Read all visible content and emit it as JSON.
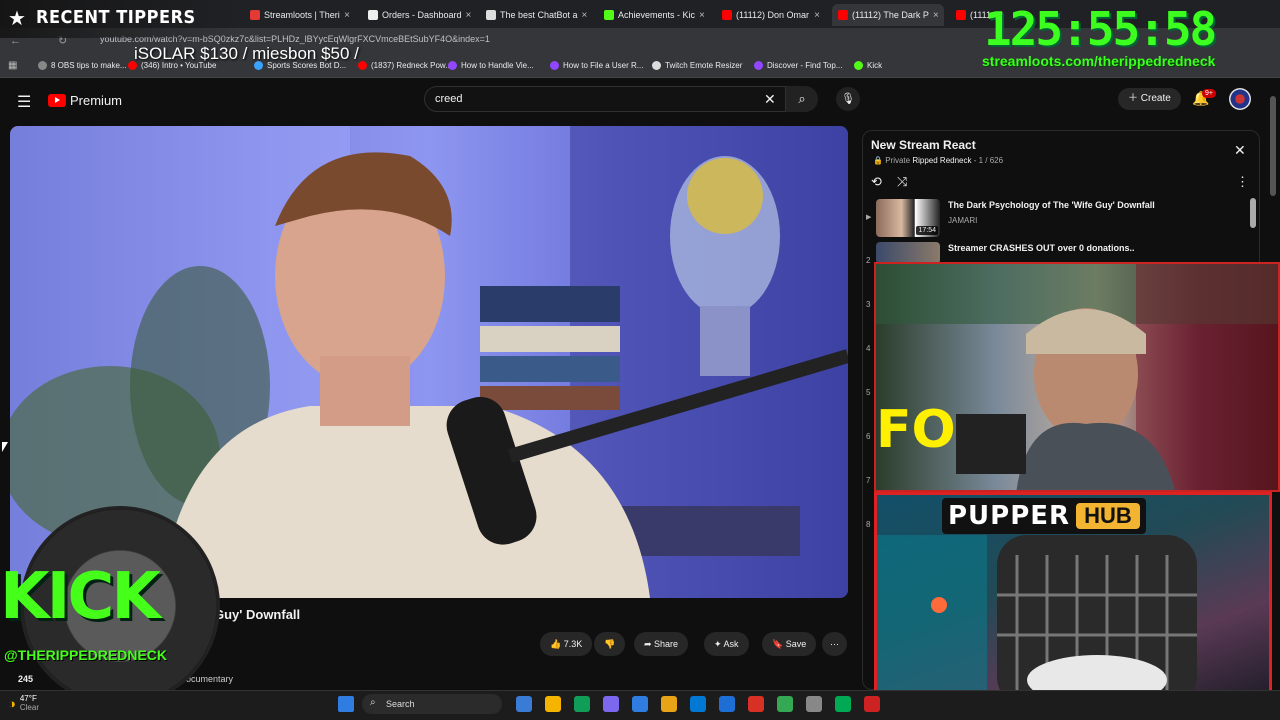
{
  "browser": {
    "tabs": [
      {
        "title": "Streamloots | Theri",
        "color": "#e53935"
      },
      {
        "title": "Orders - Dashboard",
        "color": "#eeeeee"
      },
      {
        "title": "The best ChatBot a",
        "color": "#dddddd"
      },
      {
        "title": "Achievements - Kic",
        "color": "#53fc18"
      },
      {
        "title": "(11112) Don Omar",
        "color": "#ff0000"
      },
      {
        "title": "(11112) The Dark P",
        "color": "#ff0000"
      },
      {
        "title": "(1111",
        "color": "#ff0000"
      }
    ],
    "url": "youtube.com/watch?v=m-bSQ0zkz7c&list=PLHDz_lBYycEqWlgrFXCVmceBEtSubYF4O&index=1",
    "bookmarks": [
      {
        "label": "8 OBS tips to make...",
        "color": "#888888"
      },
      {
        "label": "(346) Intro • YouTube",
        "color": "#ff0000"
      },
      {
        "label": "Sports Scores Bot D...",
        "color": "#3aa3ff"
      },
      {
        "label": "(1837) Redneck Pow...",
        "color": "#ff0000"
      },
      {
        "label": "How to Handle Vie...",
        "color": "#9146ff"
      },
      {
        "label": "How to File a User R...",
        "color": "#9146ff"
      },
      {
        "label": "Twitch Emote Resizer",
        "color": "#dddddd"
      },
      {
        "label": "Discover - Find Top...",
        "color": "#9146ff"
      },
      {
        "label": "Kick",
        "color": "#53fc18"
      }
    ]
  },
  "youtube": {
    "logo_text": "Premium",
    "search_value": "creed",
    "create_label": "Create",
    "notif_badge": "9+",
    "video_title_visible": "Guy' Downfall",
    "actions": {
      "likes": "7.3K",
      "share": "Share",
      "ask": "Ask",
      "save": "Save"
    },
    "views_partial": "245",
    "desc_partial": "ocumentary"
  },
  "playlist": {
    "title": "New Stream React",
    "privacy": "Private",
    "owner": "Ripped Redneck",
    "position": "1 / 626",
    "items": [
      {
        "title": "The Dark Psychology of The 'Wife Guy' Downfall",
        "channel": "JAMARI",
        "duration": "17:54"
      },
      {
        "title": "Streamer CRASHES OUT over 0 donations..",
        "channel": "",
        "duration": ""
      }
    ],
    "numbers": [
      "2",
      "3",
      "4",
      "5",
      "6",
      "7",
      "8"
    ]
  },
  "overlay": {
    "recent_tippers_label": "RECENT TIPPERS",
    "tippers_text": "iSOLAR $130 / miesbon $50 /",
    "timer": "125:55:58",
    "streamloots_url": "streamloots.com/therippedredneck",
    "pupper_a": "PUPPER",
    "pupper_b": "HUB",
    "kick_word": "KICK",
    "kick_handle": "@THERIPPEDREDNECK",
    "cam_text": "FO"
  },
  "taskbar": {
    "weather_temp": "47°F",
    "weather_desc": "Clear",
    "search_label": "Search"
  }
}
